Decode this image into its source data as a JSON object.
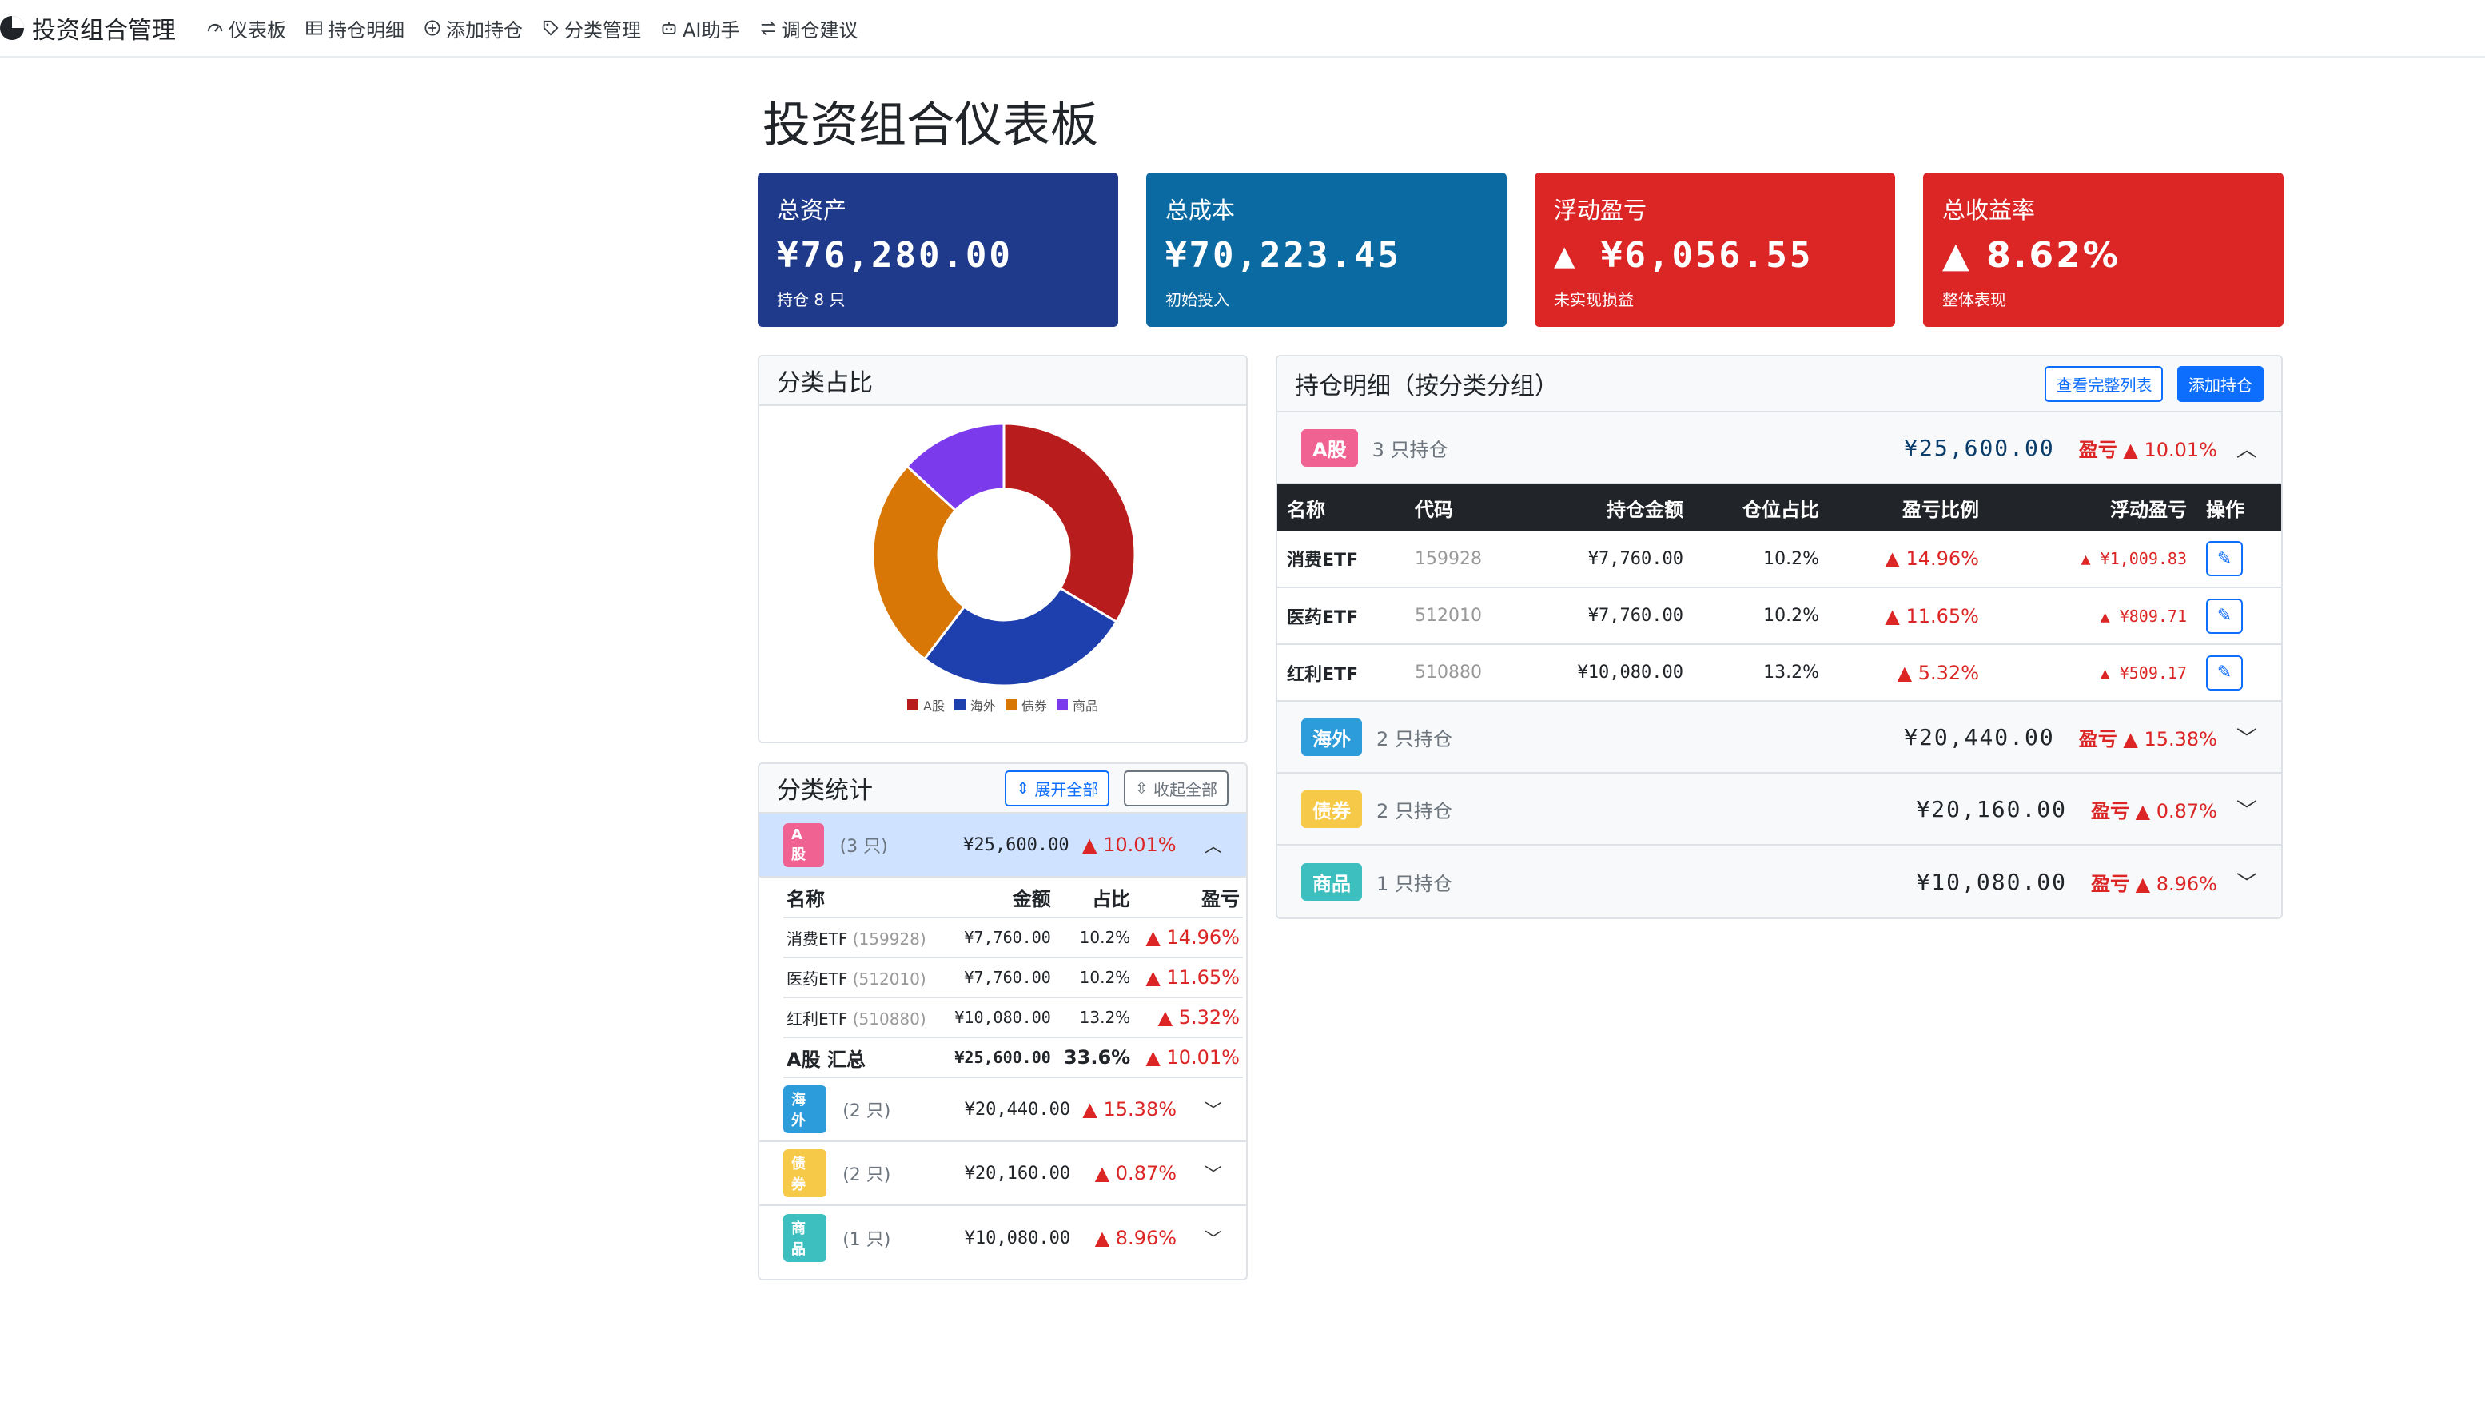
{
  "nav": {
    "brand": "投资组合管理",
    "items": [
      {
        "label": "仪表板",
        "icon": "dashboard-icon"
      },
      {
        "label": "持仓明细",
        "icon": "table-icon"
      },
      {
        "label": "添加持仓",
        "icon": "plus-circle-icon"
      },
      {
        "label": "分类管理",
        "icon": "tag-icon"
      },
      {
        "label": "AI助手",
        "icon": "robot-icon"
      },
      {
        "label": "调仓建议",
        "icon": "swap-icon"
      }
    ]
  },
  "page_title": "投资组合仪表板",
  "summary": {
    "total_assets": {
      "label": "总资产",
      "value": "¥76,280.00",
      "sub": "持仓 8 只"
    },
    "total_cost": {
      "label": "总成本",
      "value": "¥70,223.45",
      "sub": "初始投入"
    },
    "floating_pl": {
      "label": "浮动盈亏",
      "value": "▲ ¥6,056.55",
      "sub": "未实现损益"
    },
    "total_return": {
      "label": "总收益率",
      "value": "▲ 8.62%",
      "sub": "整体表现"
    }
  },
  "pie": {
    "title": "分类占比",
    "colors": {
      "a": "#b91c1c",
      "hw": "#1e40af",
      "zq": "#d97706",
      "sp": "#7c3aed"
    },
    "legend": [
      "A股",
      "海外",
      "债券",
      "商品"
    ]
  },
  "chart_data": {
    "type": "pie",
    "categories": [
      "A股",
      "海外",
      "债券",
      "商品"
    ],
    "values": [
      25600.0,
      20440.0,
      20160.0,
      10080.0
    ],
    "donut": true,
    "legend_position": "bottom"
  },
  "stats": {
    "title": "分类统计",
    "expand_all": "展开全部",
    "collapse_all": "收起全部",
    "cols": {
      "name": "名称",
      "amount": "金额",
      "ratio": "占比",
      "pl": "盈亏"
    },
    "groups": [
      {
        "badge": "A股",
        "count": "(3 只)",
        "amount": "¥25,600.00",
        "pct": "▲ 10.01%",
        "chev": "︿"
      },
      {
        "badge": "海外",
        "count": "(2 只)",
        "amount": "¥20,440.00",
        "pct": "▲ 15.38%",
        "chev": "﹀"
      },
      {
        "badge": "债券",
        "count": "(2 只)",
        "amount": "¥20,160.00",
        "pct": "▲ 0.87%",
        "chev": "﹀"
      },
      {
        "badge": "商品",
        "count": "(1 只)",
        "amount": "¥10,080.00",
        "pct": "▲ 8.96%",
        "chev": "﹀"
      }
    ],
    "a_rows": [
      {
        "name": "消费ETF",
        "code": "(159928)",
        "amount": "¥7,760.00",
        "ratio": "10.2%",
        "pl": "▲ 14.96%"
      },
      {
        "name": "医药ETF",
        "code": "(512010)",
        "amount": "¥7,760.00",
        "ratio": "10.2%",
        "pl": "▲ 11.65%"
      },
      {
        "name": "红利ETF",
        "code": "(510880)",
        "amount": "¥10,080.00",
        "ratio": "13.2%",
        "pl": "▲ 5.32%"
      }
    ],
    "a_total": {
      "name": "A股 汇总",
      "amount": "¥25,600.00",
      "ratio": "33.6%",
      "pl": "▲ 10.01%"
    }
  },
  "holdings": {
    "title": "持仓明细（按分类分组）",
    "view_all": "查看完整列表",
    "add": "添加持仓",
    "pl_label": "盈亏",
    "groups": [
      {
        "badge": "A股",
        "count": "3 只持仓",
        "amount": "¥25,600.00",
        "pl": "▲ 10.01%",
        "chev": "︿"
      },
      {
        "badge": "海外",
        "count": "2 只持仓",
        "amount": "¥20,440.00",
        "pl": "▲ 15.38%",
        "chev": "﹀"
      },
      {
        "badge": "债券",
        "count": "2 只持仓",
        "amount": "¥20,160.00",
        "pl": "▲ 0.87%",
        "chev": "﹀"
      },
      {
        "badge": "商品",
        "count": "1 只持仓",
        "amount": "¥10,080.00",
        "pl": "▲ 8.96%",
        "chev": "﹀"
      }
    ],
    "cols": {
      "name": "名称",
      "code": "代码",
      "amount": "持仓金额",
      "ratio": "仓位占比",
      "pl_ratio": "盈亏比例",
      "pl": "浮动盈亏",
      "op": "操作"
    },
    "rows": [
      {
        "name": "消费ETF",
        "code": "159928",
        "amount": "¥7,760.00",
        "ratio": "10.2%",
        "pl_ratio": "▲ 14.96%",
        "pl": "▲ ¥1,009.83"
      },
      {
        "name": "医药ETF",
        "code": "512010",
        "amount": "¥7,760.00",
        "ratio": "10.2%",
        "pl_ratio": "▲ 11.65%",
        "pl": "▲ ¥809.71"
      },
      {
        "name": "红利ETF",
        "code": "510880",
        "amount": "¥10,080.00",
        "ratio": "13.2%",
        "pl_ratio": "▲ 5.32%",
        "pl": "▲ ¥509.17"
      }
    ]
  }
}
